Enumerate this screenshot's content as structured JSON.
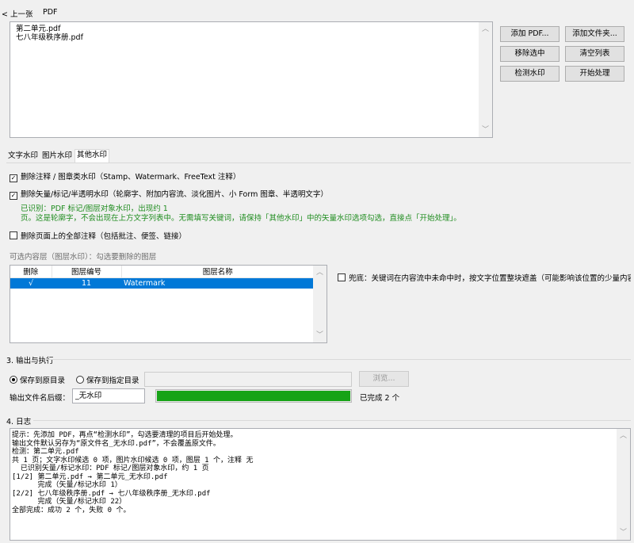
{
  "nav": {
    "back_label": "< 上一张",
    "pdf_section": "PDF"
  },
  "file_list": [
    "第二单元.pdf",
    "七八年级秩序册.pdf"
  ],
  "file_buttons": {
    "add_pdf": "添加 PDF...",
    "add_folder": "添加文件夹...",
    "remove_selected": "移除选中",
    "clear_list": "清空列表",
    "detect_watermark": "检测水印",
    "start_process": "开始处理"
  },
  "tabs": [
    "文字水印",
    "图片水印",
    "其他水印"
  ],
  "other_tab": {
    "opt_annotations": "删除注释 / 图章类水印（Stamp、Watermark、FreeText 注释）",
    "opt_vector": "删除矢量/标记/半透明水印（轮廓字、附加内容流、淡化图片、小 Form 图章、半透明文字）",
    "info_line1": "已识别：PDF 标记/图层对象水印，出现约 1",
    "info_line2": "页。这是轮廓字，不会出现在上方文字列表中。无需填写关键词，请保持「其他水印」中的矢量水印选项勾选，直接点「开始处理」。",
    "opt_all_annots": "删除页面上的全部注释（包括批注、便签、链接）",
    "layers_label": "可选内容层（图层水印）：勾选要删除的图层",
    "layers_headers": [
      "删除",
      "图层编号",
      "图层名称"
    ],
    "layers_rows": [
      {
        "del": "√",
        "id": "11",
        "name": "Watermark"
      }
    ],
    "fallback_label": "兜底：关键词在内容流中未命中时，按文字位置整块遮盖（可能影响该位置的少量内容）"
  },
  "output": {
    "section_title": "3. 输出与执行",
    "radio_original": "保存到原目录",
    "radio_specified": "保存到指定目录",
    "browse_label": "浏览...",
    "suffix_label": "输出文件名后缀：",
    "suffix_value": "_无水印",
    "progress": 1.0,
    "progress_color": "#17a317",
    "status": "已完成 2 个"
  },
  "log": {
    "section_title": "4. 日志",
    "lines": [
      "提示：先添加 PDF，再点“检测水印”，勾选要清理的项目后开始处理。",
      "输出文件默认另存为“原文件名_无水印.pdf”，不会覆盖原文件。",
      "检测：第二单元.pdf",
      "共 1 页；文字水印候选 0 项，图片水印候选 0 项，图层 1 个，注释 无",
      "  已识别矢量/标记水印：PDF 标记/图层对象水印，约 1 页",
      "[1/2] 第二单元.pdf → 第二单元_无水印.pdf",
      "      完成（矢量/标记水印 1）",
      "[2/2] 七八年级秩序册.pdf → 七八年级秩序册_无水印.pdf",
      "      完成（矢量/标记水印 22）",
      "全部完成：成功 2 个，失败 0 个。"
    ]
  },
  "colors": {
    "selection": "#0078d7",
    "accent_green": "#1e8c1e"
  }
}
